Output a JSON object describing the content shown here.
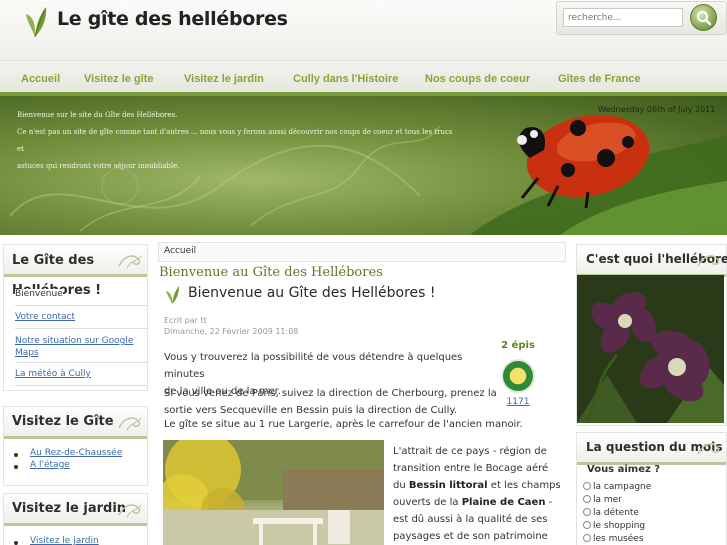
{
  "site": {
    "title": "Le gîte des hellébores"
  },
  "search": {
    "placeholder": "recherche..."
  },
  "nav": {
    "items": [
      "Accueil",
      "Visitez le gîte",
      "Visitez le jardin",
      "Cully dans l'Histoire",
      "Nos coups de coeur",
      "Gîtes de France"
    ]
  },
  "banner": {
    "line1": "Bienvenue sur le site du Gîte des Hellébores.",
    "line2": "Ce n'est pas un site de gîte comme tant d'autres ... nous vous y ferons aussi découvrir nos coups de coeur et tous les trucs et",
    "line3": "astuces qui rendront votre séjour inoubliable.",
    "date": "Wednesday 06th of July 2011"
  },
  "left": {
    "box1": {
      "title": "Le Gîte des Hellébores !",
      "title_line1": "Le Gîte des",
      "title_line2": "Hellébores !",
      "items": [
        "Bienvenue",
        "Votre contact",
        "Notre situation sur Google Maps",
        "La météo à Cully"
      ],
      "gmaps_line1": "Notre situation sur Google",
      "gmaps_line2": "Maps"
    },
    "box2": {
      "title": "Visitez le Gîte",
      "items": [
        "Au Rez-de-Chaussée",
        "A l'étage"
      ]
    },
    "box3": {
      "title": "Visitez le jardin",
      "items": [
        "Visitez le jardin"
      ]
    }
  },
  "main": {
    "breadcrumb": "Accueil",
    "section_title": "Bienvenue au Gîte des Hellébores",
    "article_title": "Bienvenue au Gîte des Hellébores !",
    "author": "Ecrit par tt",
    "date": "Dimanche, 22 Février 2009 11:08",
    "p1_line1": "Vous y trouverez la possibilité de vous détendre à quelques minutes",
    "p1_line2": "de la ville ou de la mer.",
    "p2_line1": "Si vous venez de Paris, suivez la direction de Cherbourg, prenez la",
    "p2_line2": "sortie vers Secqueville en Bessin puis la direction de Cully.",
    "p2_line3": "Le gîte se situe au 1 rue Largerie, après le carrefour de l'ancien manoir.",
    "p3": {
      "l1": "L'attrait de ce pays - région de",
      "l2": "transition entre le Bocage aéré",
      "l3a": "du ",
      "l3b": "Bessin littoral",
      "l3c": " et les champs",
      "l4a": "ouverts de la ",
      "l4b": "Plaine de Caen",
      "l4c": " -",
      "l5": "est dû aussi à la qualité de ses",
      "l6": "paysages et de son patrimoine"
    },
    "epis": {
      "label": "2 épis",
      "count": "1171"
    }
  },
  "right": {
    "box1": {
      "title": "C'est quoi l'hellébore"
    },
    "poll": {
      "title": "La question du mois",
      "question": "Vous aimez ?",
      "options": [
        "la campagne",
        "la mer",
        "la détente",
        "le shopping",
        "les musées"
      ]
    }
  },
  "colors": {
    "accent": "#8aa33a",
    "link": "#3a6aa8",
    "section_title": "#5a7a28"
  }
}
